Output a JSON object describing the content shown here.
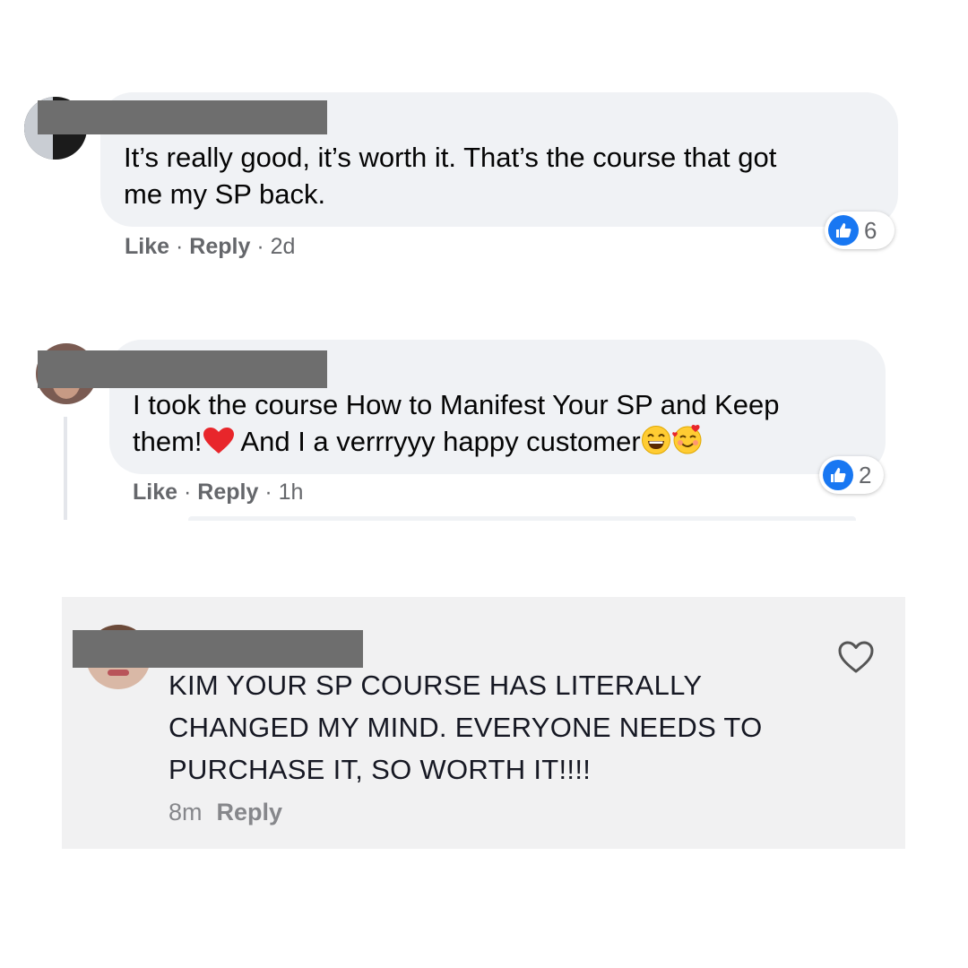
{
  "comments": [
    {
      "text_line1": "It’s really good, it’s worth it. That’s the course that got",
      "text_line2": "me my SP back.",
      "like_label": "Like",
      "reply_label": "Reply",
      "sep": "·",
      "time": "2d",
      "reaction_count": "6"
    },
    {
      "text_line1": "I took the course How to Manifest Your SP and Keep",
      "text_line2a": "them!",
      "text_line2b": " And I a verrryyy happy customer",
      "like_label": "Like",
      "reply_label": "Reply",
      "sep": "·",
      "time": "1h",
      "reaction_count": "2",
      "emojis": [
        "red-heart",
        "grinning-face",
        "smiling-face-with-hearts"
      ]
    }
  ],
  "tiktok_comment": {
    "lines": [
      "KIM YOUR SP COURSE HAS LITERALLY",
      "CHANGED MY MIND. EVERYONE NEEDS TO",
      "PURCHASE IT, SO WORTH IT!!!!"
    ],
    "time": "8m",
    "reply_label": "Reply",
    "icon": "heart-outline-icon"
  },
  "colors": {
    "bubble": "#f0f2f5",
    "facebook_blue": "#1877f2",
    "redaction": "#6e6e6e",
    "tiktok_panel": "#f1f1f2"
  }
}
